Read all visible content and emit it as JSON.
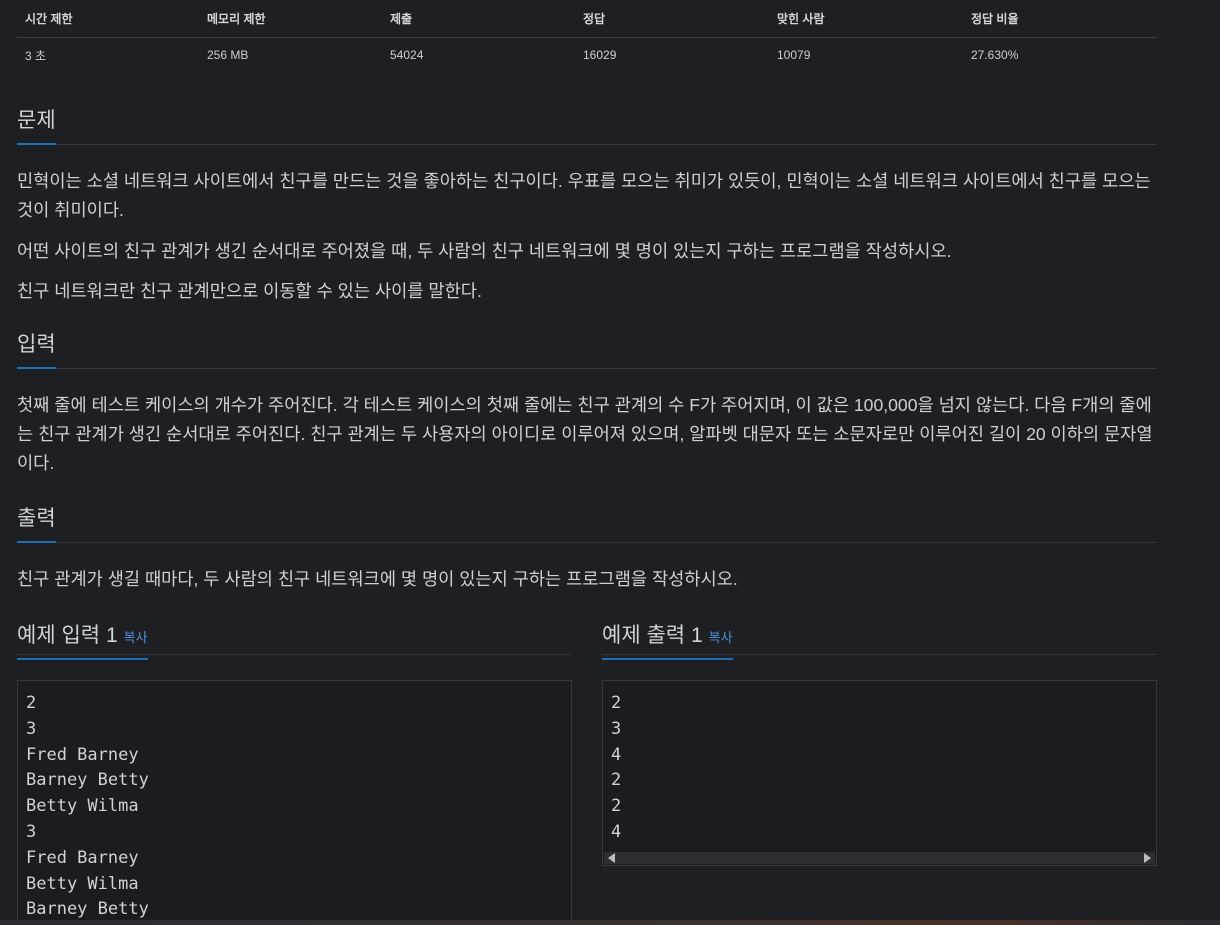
{
  "stats": {
    "headers": [
      "시간 제한",
      "메모리 제한",
      "제출",
      "정답",
      "맞힌 사람",
      "정답 비율"
    ],
    "values": [
      "3 초",
      "256 MB",
      "54024",
      "16029",
      "10079",
      "27.630%"
    ]
  },
  "problem": {
    "title": "문제",
    "paragraphs": [
      "민혁이는 소셜 네트워크 사이트에서 친구를 만드는 것을 좋아하는 친구이다. 우표를 모으는 취미가 있듯이, 민혁이는 소셜 네트워크 사이트에서 친구를 모으는 것이 취미이다.",
      "어떤 사이트의 친구 관계가 생긴 순서대로 주어졌을 때, 두 사람의 친구 네트워크에 몇 명이 있는지 구하는 프로그램을 작성하시오.",
      "친구 네트워크란 친구 관계만으로 이동할 수 있는 사이를 말한다."
    ]
  },
  "input": {
    "title": "입력",
    "text": "첫째 줄에 테스트 케이스의 개수가 주어진다. 각 테스트 케이스의 첫째 줄에는 친구 관계의 수 F가 주어지며, 이 값은 100,000을 넘지 않는다. 다음 F개의 줄에는 친구 관계가 생긴 순서대로 주어진다. 친구 관계는 두 사용자의 아이디로 이루어져 있으며, 알파벳 대문자 또는 소문자로만 이루어진 길이 20 이하의 문자열이다."
  },
  "output": {
    "title": "출력",
    "text": "친구 관계가 생길 때마다, 두 사람의 친구 네트워크에 몇 명이 있는지 구하는 프로그램을 작성하시오."
  },
  "example_input": {
    "title": "예제 입력 1",
    "copy_label": "복사",
    "lines": [
      "2",
      "3",
      "Fred Barney",
      "Barney Betty",
      "Betty Wilma",
      "3",
      "Fred Barney",
      "Betty Wilma",
      "Barney Betty"
    ]
  },
  "example_output": {
    "title": "예제 출력 1",
    "copy_label": "복사",
    "lines": [
      "2",
      "3",
      "4",
      "2",
      "2",
      "4"
    ]
  }
}
